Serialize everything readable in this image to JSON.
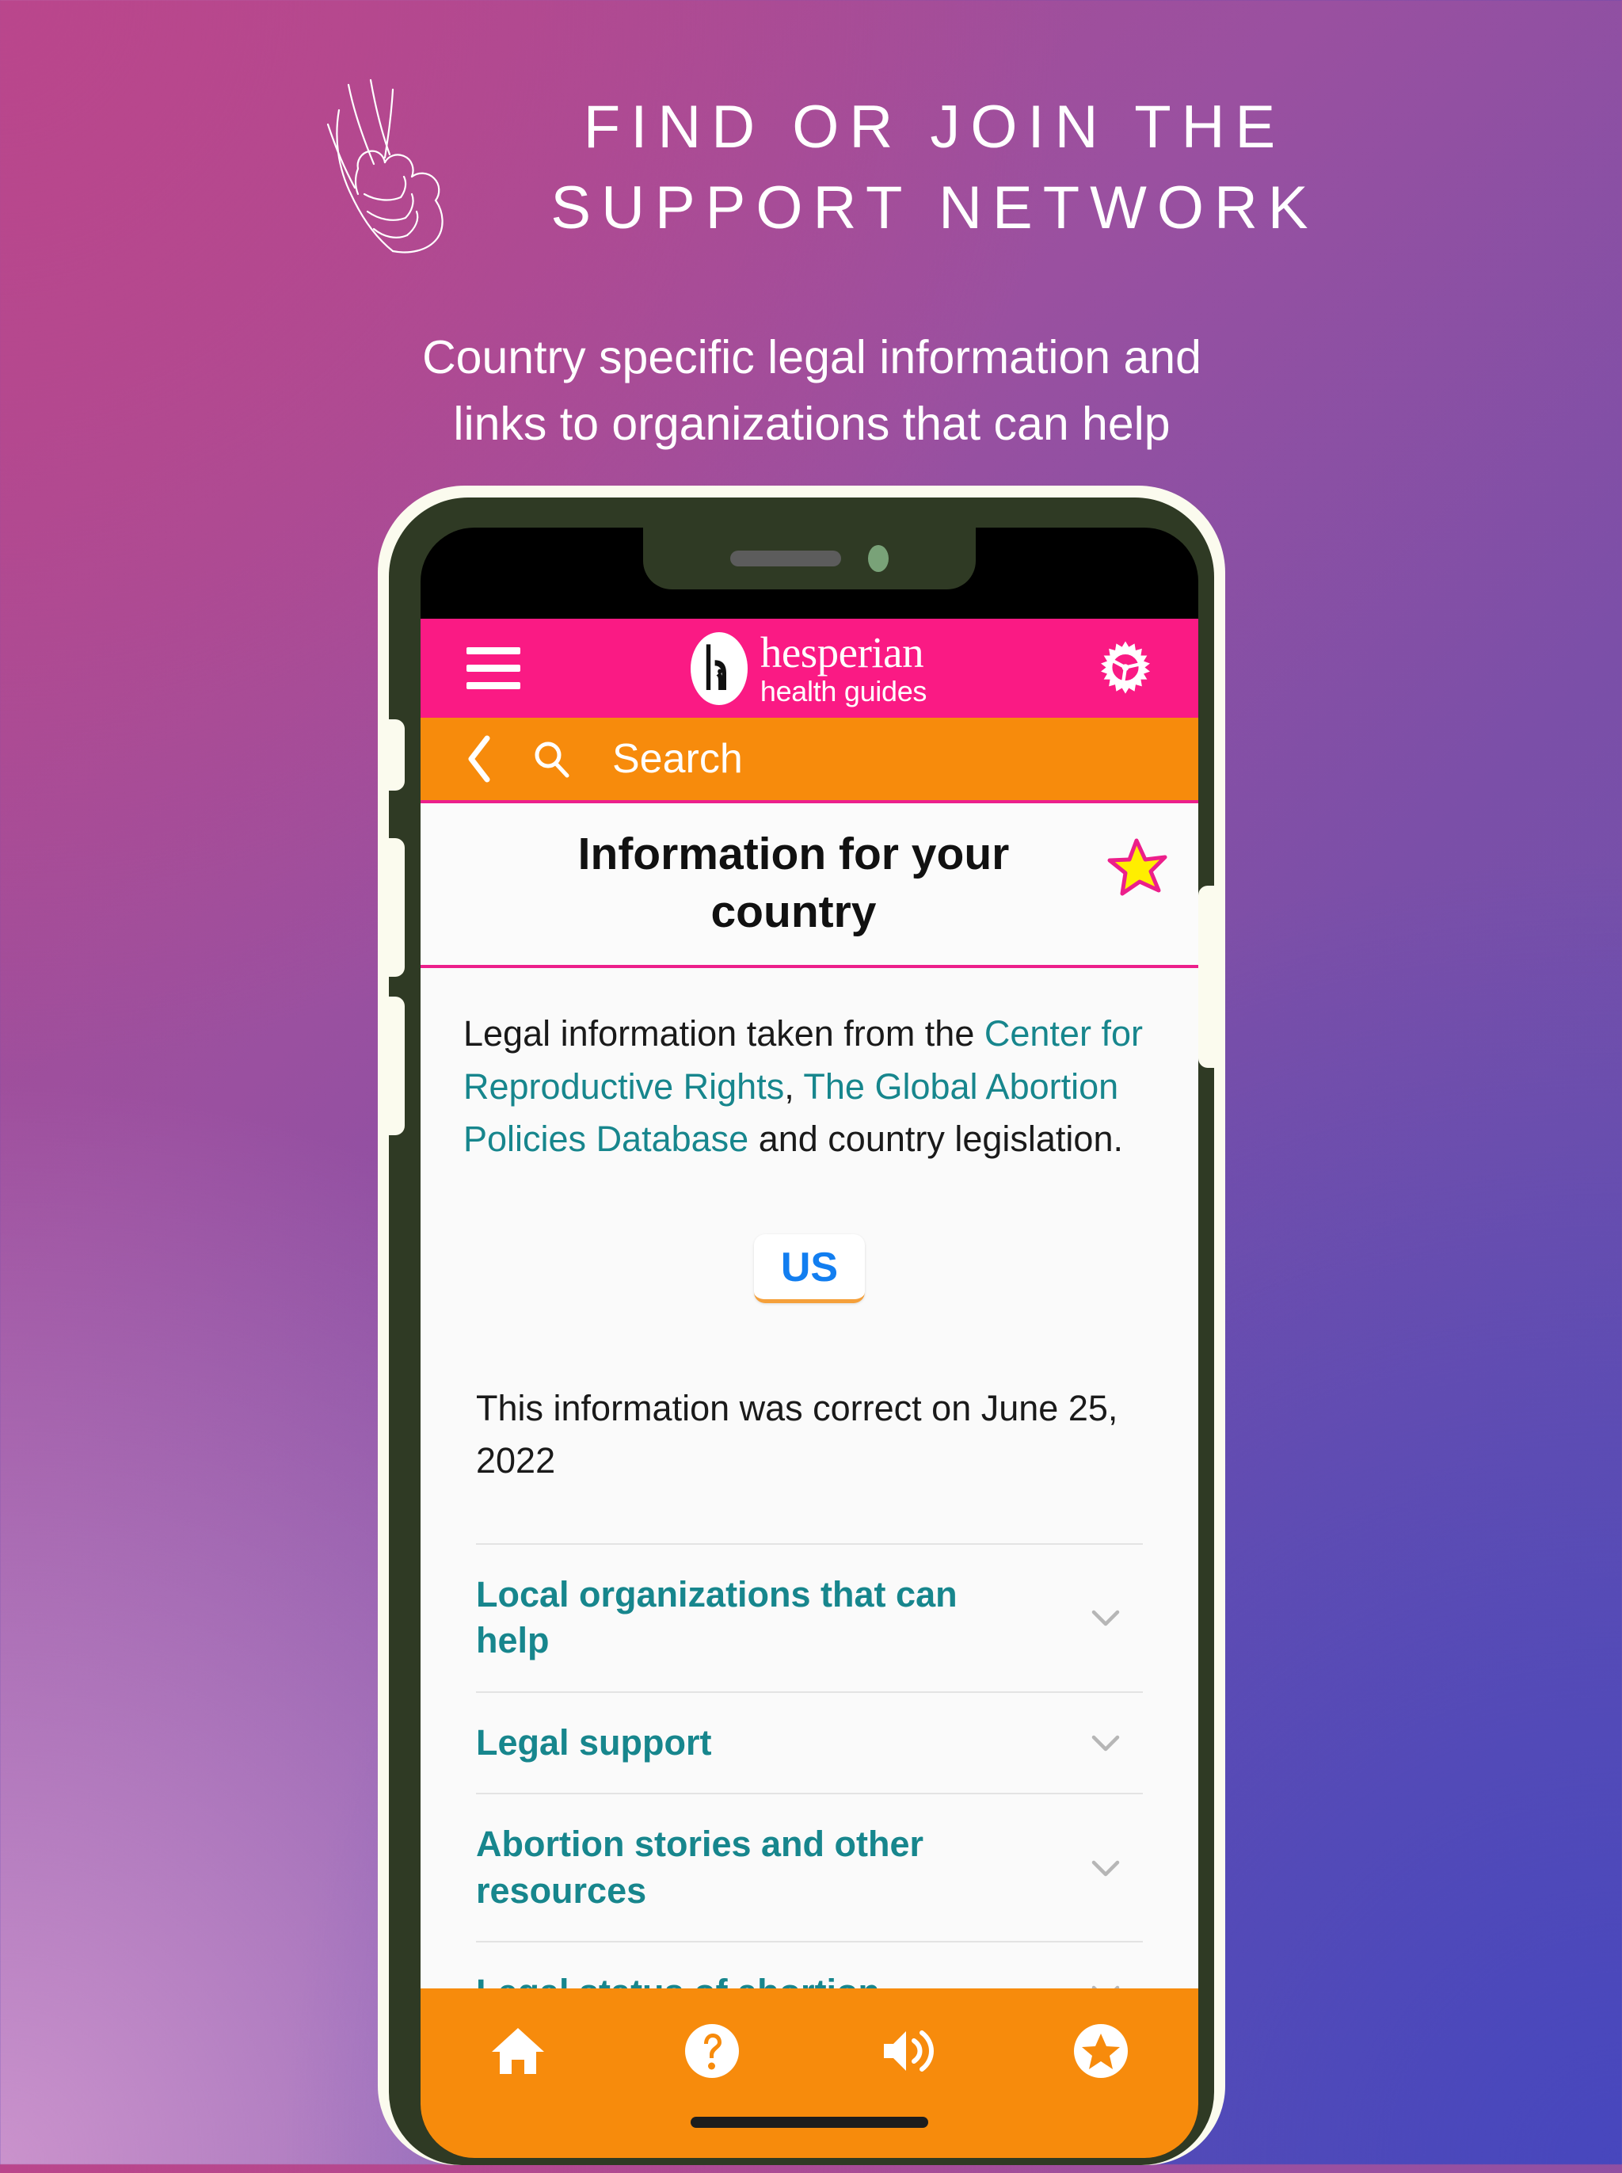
{
  "banner": {
    "title_line1": "FIND OR JOIN THE",
    "title_line2": "SUPPORT NETWORK",
    "subtitle_line1": "Country specific legal information and",
    "subtitle_line2": "links to organizations that can help",
    "hands_icon": "holding-hands-icon"
  },
  "colors": {
    "brand_pink": "#fa1a84",
    "accent_orange": "#f78b0c",
    "link_teal": "#17868d",
    "country_blue": "#127ef0",
    "star_yellow": "#ffee00",
    "star_outline": "#ec1f8b",
    "bg_top_left": "#b5498c",
    "bg_top_right": "#7b4fa8",
    "bg_bottom_left": "#c08fc4",
    "bg_bottom_right": "#5050b2",
    "phone_frame": "#2f3a24",
    "phone_edge": "#fbfbee"
  },
  "app": {
    "header": {
      "menu_icon": "hamburger-menu-icon",
      "logo_mark": "hesperian-logo-mark",
      "brand_name": "hesperian",
      "brand_tagline": "health guides",
      "settings_icon": "gear-icon"
    },
    "search": {
      "back_icon": "back-chevron-icon",
      "search_icon": "search-icon",
      "placeholder": "Search"
    },
    "page": {
      "title": "Information for your country",
      "favorite_icon": "star-favorite-icon",
      "intro": {
        "part1": "Legal information taken from the ",
        "link1": "Center for Reproductive Rights",
        "separator": ", ",
        "link2": "The Global Abortion Policies Database",
        "part2": " and country legislation."
      },
      "country_selector": {
        "value": "US"
      },
      "correct_on": "This information was correct on June 25, 2022",
      "accordion": [
        {
          "label": "Local organizations that can help",
          "chevron": "chevron-down-icon"
        },
        {
          "label": "Legal support",
          "chevron": "chevron-down-icon"
        },
        {
          "label": "Abortion stories and other resources",
          "chevron": "chevron-down-icon"
        },
        {
          "label": "Legal status of abortion",
          "chevron": "chevron-down-icon"
        }
      ]
    },
    "bottom_nav": [
      {
        "icon": "home-icon",
        "name": "home"
      },
      {
        "icon": "question-help-icon",
        "name": "help"
      },
      {
        "icon": "speaker-audio-icon",
        "name": "audio"
      },
      {
        "icon": "star-badge-icon",
        "name": "favorites"
      }
    ]
  }
}
